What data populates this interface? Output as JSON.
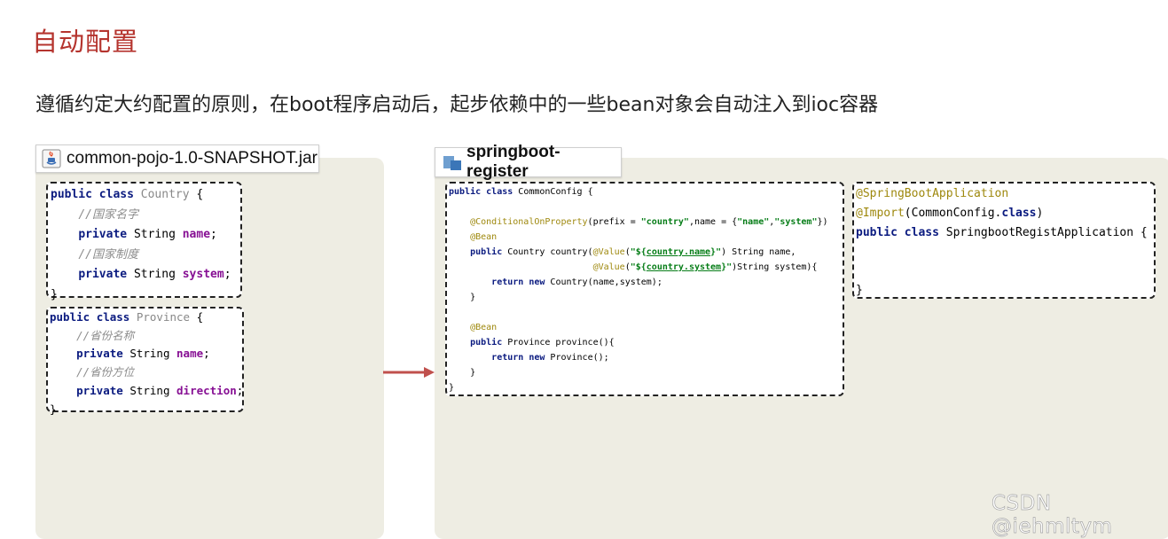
{
  "title": "自动配置",
  "subtitle": "遵循约定大约配置的原则，在boot程序启动后，起步依赖中的一些bean对象会自动注入到ioc容器",
  "left_panel": {
    "file_name": "common-pojo-1.0-SNAPSHOT.jar",
    "icon": "jar-icon",
    "country_class": {
      "kw1": "public",
      "kw2": "class",
      "name": "Country",
      "brace": "{",
      "comment1": "//国家名字",
      "f1_mod": "private",
      "f1_type": "String",
      "f1_name": "name",
      "comment2": "//国家制度",
      "f2_mod": "private",
      "f2_type": "String",
      "f2_name": "system",
      "close": "}"
    },
    "province_class": {
      "kw1": "public",
      "kw2": "class",
      "name": "Province",
      "brace": "{",
      "comment1": "//省份名称",
      "f1_mod": "private",
      "f1_type": "String",
      "f1_name": "name",
      "comment2": "//省份方位",
      "f2_mod": "private",
      "f2_type": "String",
      "f2_name": "direction",
      "close": "}"
    }
  },
  "right_panel": {
    "project_name": "springboot-register",
    "icon": "folder-icon",
    "config_class": {
      "l1_kw1": "public",
      "l1_kw2": "class",
      "l1_rest": "CommonConfig {",
      "l3_anno": "@ConditionalOnProperty",
      "l3_a": "(prefix = ",
      "l3_s1": "\"country\"",
      "l3_b": ",name = {",
      "l3_s2": "\"name\"",
      "l3_c": ",",
      "l3_s3": "\"system\"",
      "l3_d": "})",
      "l4_anno": "@Bean",
      "l5_kw": "public",
      "l5_a": "Country country(",
      "l5_anno": "@Value",
      "l5_b": "(",
      "l5_s_pre": "\"${",
      "l5_s_mid": "country.name",
      "l5_s_post": "}\"",
      "l5_c": ") String name,",
      "l6_anno": "@Value",
      "l6_b": "(",
      "l6_s_pre": "\"${",
      "l6_s_mid": "country.system",
      "l6_s_post": "}\"",
      "l6_c": ")String system){",
      "l7_kw1": "return",
      "l7_kw2": "new",
      "l7_rest": "Country(name,system);",
      "l8": "}",
      "l10_anno": "@Bean",
      "l11_kw": "public",
      "l11_rest": "Province province(){",
      "l12_kw1": "return",
      "l12_kw2": "new",
      "l12_rest": "Province();",
      "l13": "}",
      "l14": "}"
    },
    "app_class": {
      "anno1": "@SpringBootApplication",
      "anno2": "@Import",
      "anno2_rest_a": "(CommonConfig.",
      "anno2_kw": "class",
      "anno2_rest_b": ")",
      "kw1": "public",
      "kw2": "class",
      "name": "SpringbootRegistApplication {",
      "close": "}"
    }
  },
  "watermark": "CSDN @iehmltym",
  "colors": {
    "title": "#b5342e",
    "panel_bg": "#eeede3",
    "arrow": "#c0504d",
    "keyword": "#0b1b80",
    "field": "#871094",
    "annotation": "#9e880d",
    "string": "#067d17",
    "comment": "#8c8c8c"
  }
}
